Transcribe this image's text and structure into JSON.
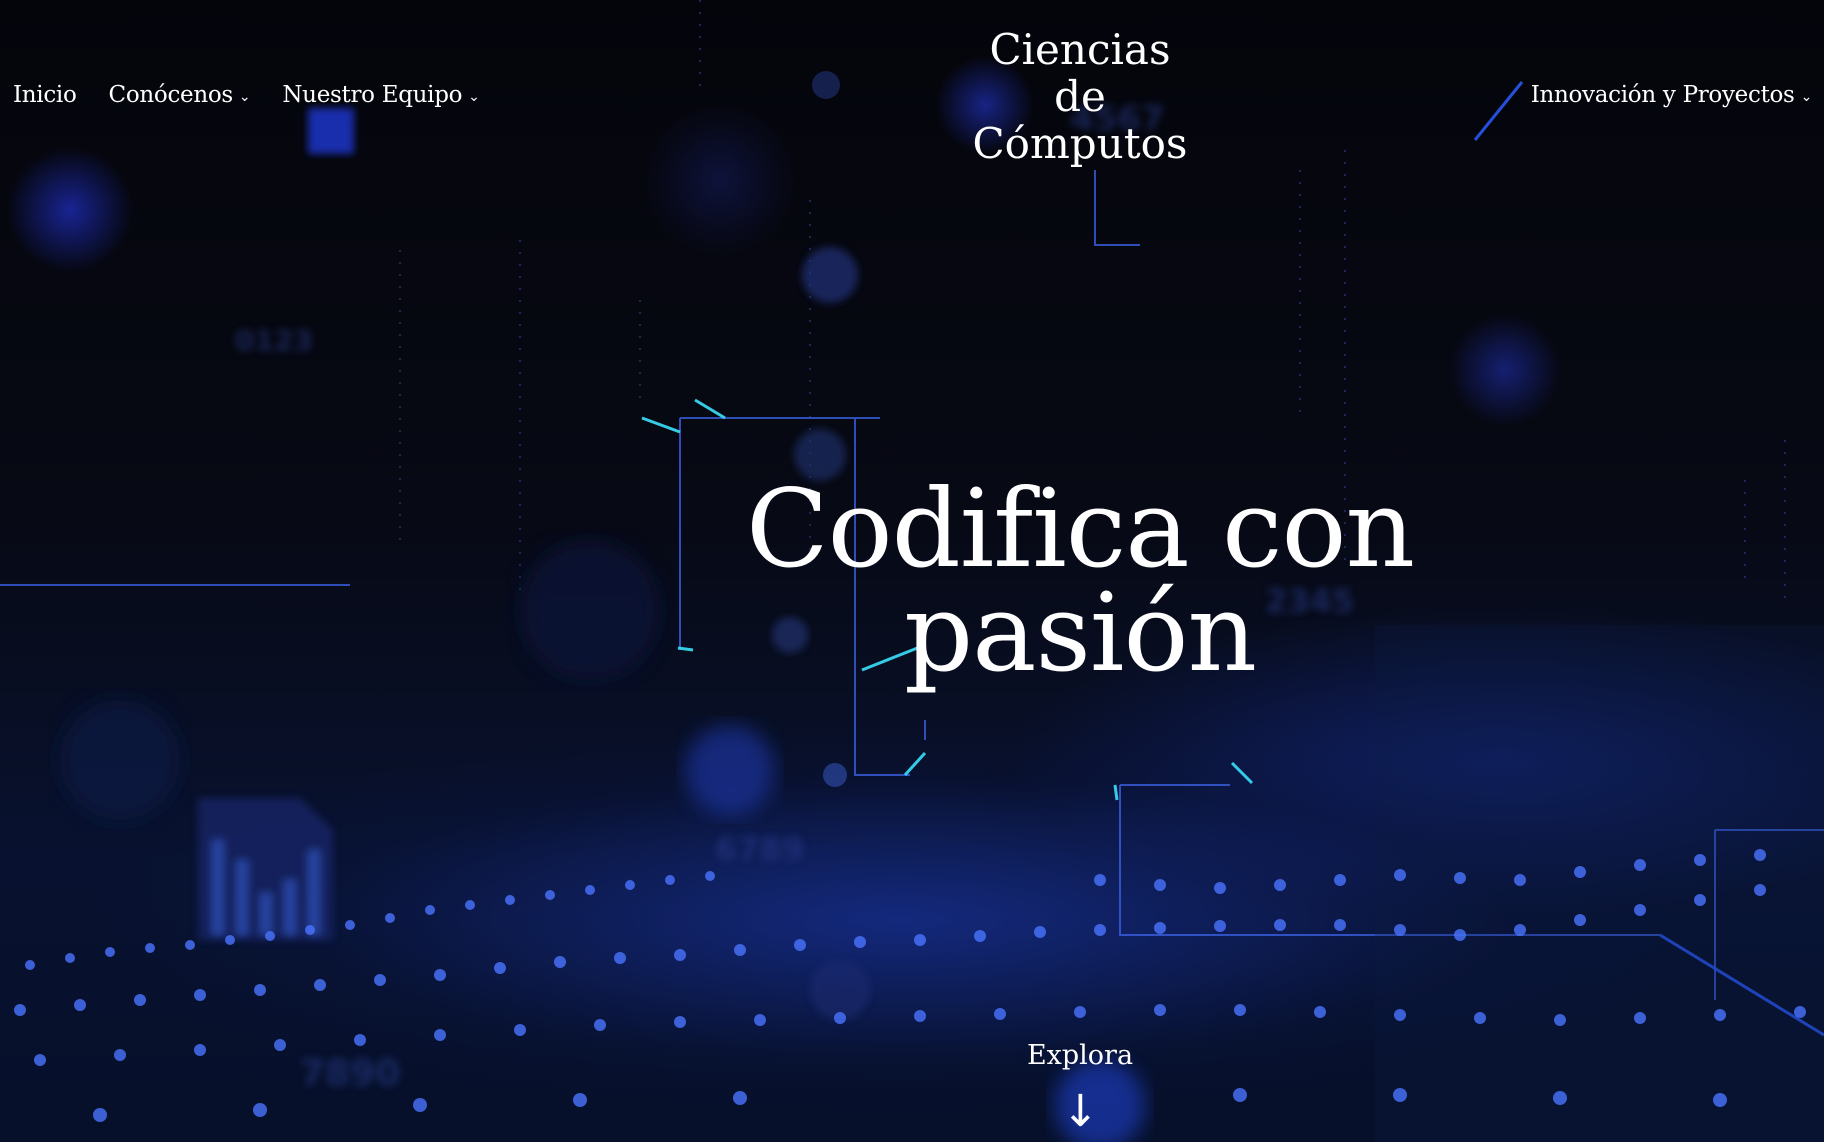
{
  "nav": {
    "left": [
      {
        "label": "Inicio",
        "has_dropdown": false
      },
      {
        "label": "Conócenos",
        "has_dropdown": true
      },
      {
        "label": "Nuestro Equipo",
        "has_dropdown": true
      }
    ],
    "right": [
      {
        "label": "Innovación y Proyectos",
        "has_dropdown": true
      }
    ],
    "dropdown_icon": "chevron-down-icon"
  },
  "logo": {
    "line1": "Ciencias",
    "line2": "de",
    "line3": "Cómputos"
  },
  "hero": {
    "headline_line1": "Codifica con",
    "headline_line2": "pasión",
    "explore_label": "Explora",
    "arrow_icon": "arrow-down-icon",
    "arrow_glyph": "↓"
  },
  "colors": {
    "background": "#05060c",
    "accent_blue": "#2a4cff",
    "accent_cyan": "#38d6f0",
    "text": "#ffffff"
  }
}
